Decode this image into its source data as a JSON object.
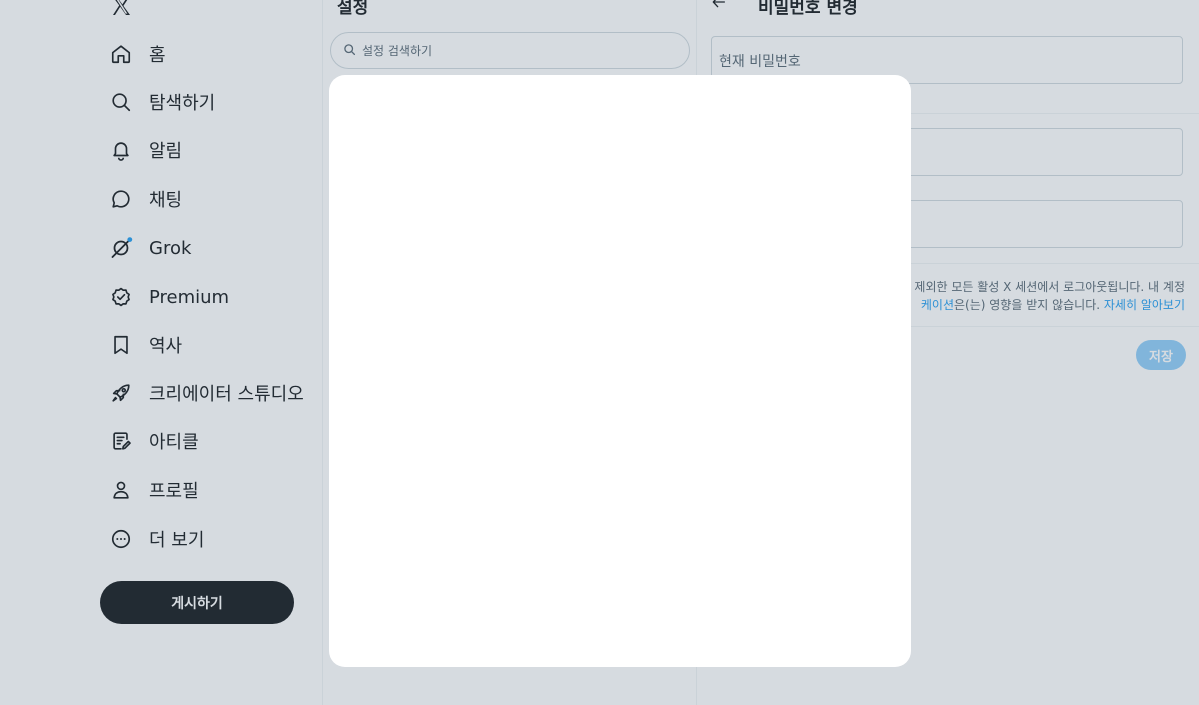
{
  "colors": {
    "accent": "#1d9bf0",
    "text": "#0f1419",
    "muted": "#536471",
    "post_button": "#0f1419",
    "save_button_disabled": "#8ecdf8",
    "overlay": "rgba(91, 112, 131, 0.25)"
  },
  "nav": {
    "logo_icon": "x-logo-icon",
    "items": [
      {
        "label": "홈",
        "icon": "home-icon"
      },
      {
        "label": "탐색하기",
        "icon": "search-icon"
      },
      {
        "label": "알림",
        "icon": "bell-icon"
      },
      {
        "label": "채팅",
        "icon": "chat-icon"
      },
      {
        "label": "Grok",
        "icon": "grok-icon"
      },
      {
        "label": "Premium",
        "icon": "verified-badge-icon"
      },
      {
        "label": "역사",
        "icon": "bookmark-icon"
      },
      {
        "label": "크리에이터 스튜디오",
        "icon": "rocket-icon"
      },
      {
        "label": "아티클",
        "icon": "article-icon"
      },
      {
        "label": "프로필",
        "icon": "person-icon"
      },
      {
        "label": "더 보기",
        "icon": "more-circle-icon"
      }
    ],
    "post_button": "게시하기"
  },
  "settings": {
    "title": "설정",
    "search_placeholder": "설정 검색하기"
  },
  "password": {
    "title": "비밀번호 변경",
    "current_placeholder": "현재 비밀번호",
    "notice_line1": "을 제외한 모든 활성 X 세션에서 로그아웃됩니다. 내 계정",
    "notice_link1": "케이션",
    "notice_line2_rest": "은(는) 영향을 받지 않습니다. ",
    "notice_link2": "자세히 알아보기",
    "save_button": "저장"
  }
}
